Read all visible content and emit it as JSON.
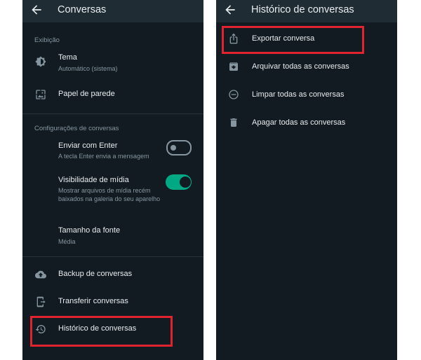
{
  "left": {
    "title": "Conversas",
    "section_display": "Exibição",
    "theme_label": "Tema",
    "theme_value": "Automático (sistema)",
    "wallpaper_label": "Papel de parede",
    "section_chats": "Configurações de conversas",
    "enter_label": "Enviar com Enter",
    "enter_sub": "A tecla Enter envia a mensagem",
    "enter_on": false,
    "media_label": "Visibilidade de mídia",
    "media_sub": "Mostrar arquivos de mídia recém baixados na galeria do seu aparelho",
    "media_on": true,
    "font_label": "Tamanho da fonte",
    "font_value": "Média",
    "backup_label": "Backup de conversas",
    "transfer_label": "Transferir conversas",
    "history_label": "Histórico de conversas"
  },
  "right": {
    "title": "Histórico de conversas",
    "items": [
      {
        "label": "Exportar conversa",
        "icon": "share-upload-icon"
      },
      {
        "label": "Arquivar todas as conversas",
        "icon": "archive-icon"
      },
      {
        "label": "Limpar todas as conversas",
        "icon": "minus-circle-icon"
      },
      {
        "label": "Apagar todas as conversas",
        "icon": "trash-icon"
      }
    ]
  },
  "colors": {
    "background": "#121b22",
    "appbar": "#1f2c34",
    "text_primary": "#e9edef",
    "text_secondary": "#8696a0",
    "accent": "#00a884",
    "highlight": "#e0232e"
  }
}
